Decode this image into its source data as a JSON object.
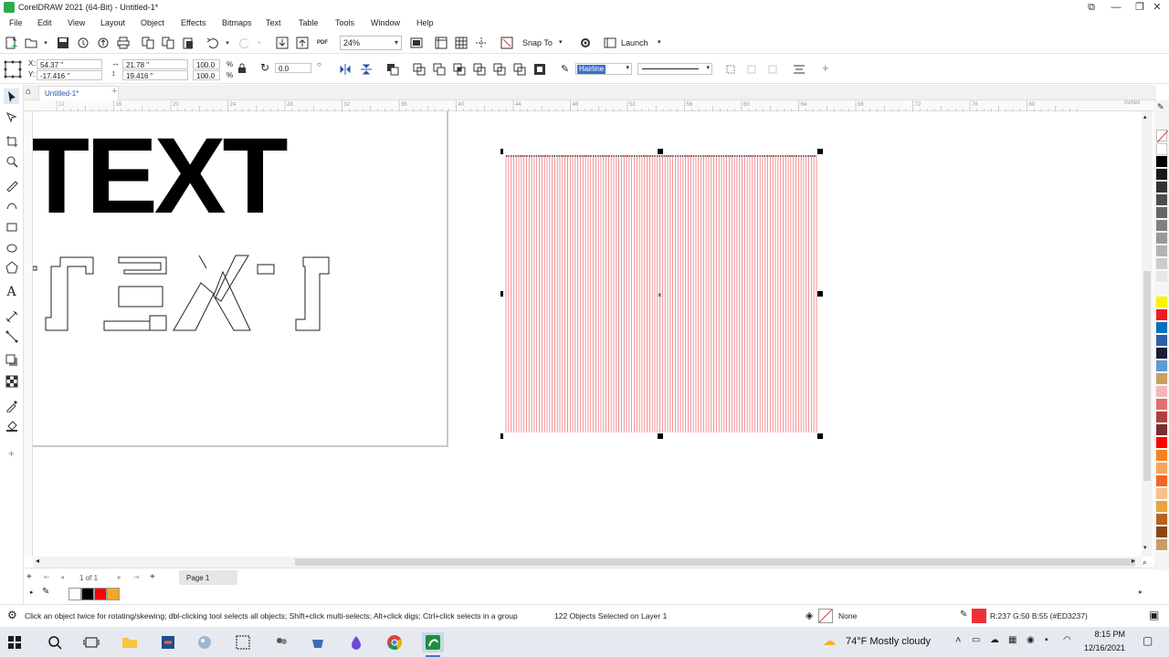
{
  "window": {
    "title": "CorelDRAW 2021 (64-Bit) - Untitled-1*",
    "controls": [
      "minimize",
      "maximize",
      "close"
    ]
  },
  "menu": [
    "File",
    "Edit",
    "View",
    "Layout",
    "Object",
    "Effects",
    "Bitmaps",
    "Text",
    "Table",
    "Tools",
    "Window",
    "Help"
  ],
  "toolbar": {
    "zoom_value": "24%",
    "snap_to_label": "Snap To",
    "launch_label": "Launch",
    "pdf_label": "PDF"
  },
  "property_bar": {
    "x_label": "X:",
    "x_value": "54.37 \"",
    "y_label": "Y:",
    "y_value": "-17.416 \"",
    "width_value": "21.78 \"",
    "height_value": "19.416 \"",
    "scale_w": "100.0",
    "scale_h": "100.0",
    "percent": "%",
    "rotation": "0.0",
    "outline_width": "Hairline"
  },
  "document_tab": "Untitled-1*",
  "ruler_numbers": [
    "12",
    "16",
    "20",
    "24",
    "28",
    "32",
    "36",
    "40",
    "44",
    "48",
    "52",
    "56",
    "60",
    "64",
    "68",
    "72",
    "76",
    "80"
  ],
  "ruler_unit": "inches",
  "canvas": {
    "solid_text": "TEXT",
    "outline_text": "TEXT",
    "hatch_line_color": "#ED3237",
    "hatch_line_count": 122
  },
  "page_nav": {
    "position": "1",
    "of_label": "of",
    "total": "1",
    "page_tab": "Page 1"
  },
  "palette_colors": [
    "#ffffff",
    "#000000",
    "#1a1a1a",
    "#333333",
    "#4d4d4d",
    "#666666",
    "#808080",
    "#999999",
    "#b3b3b3",
    "#cccccc",
    "#e6e6e6",
    "#f5f5f5",
    "#fff200",
    "#ed1c24",
    "#0072bc",
    "#2e5fa8",
    "#1b1b3a",
    "#5b9bd5",
    "#c8a060",
    "#f2b8b8",
    "#e07070",
    "#b04040",
    "#7a2e2e",
    "#ff0000",
    "#f58220",
    "#f7a35c",
    "#f26522",
    "#f9c089",
    "#e8a33d",
    "#b5651d",
    "#8b4513",
    "#c69c6d"
  ],
  "doc_palette_colors": [
    "#ffffff",
    "#000000",
    "#ff0000",
    "#f5a623"
  ],
  "status": {
    "hint": "Click an object twice for rotating/skewing; dbl-clicking tool selects all objects; Shift+click multi-selects; Alt+click digs; Ctrl+click selects in a group",
    "selection": "122 Objects Selected on Layer 1",
    "fill": "None",
    "outline_color": "R:237 G:50 B:55 (#ED3237)"
  },
  "taskbar": {
    "weather": "74°F  Mostly cloudy",
    "time": "8:15 PM",
    "date": "12/16/2021"
  }
}
